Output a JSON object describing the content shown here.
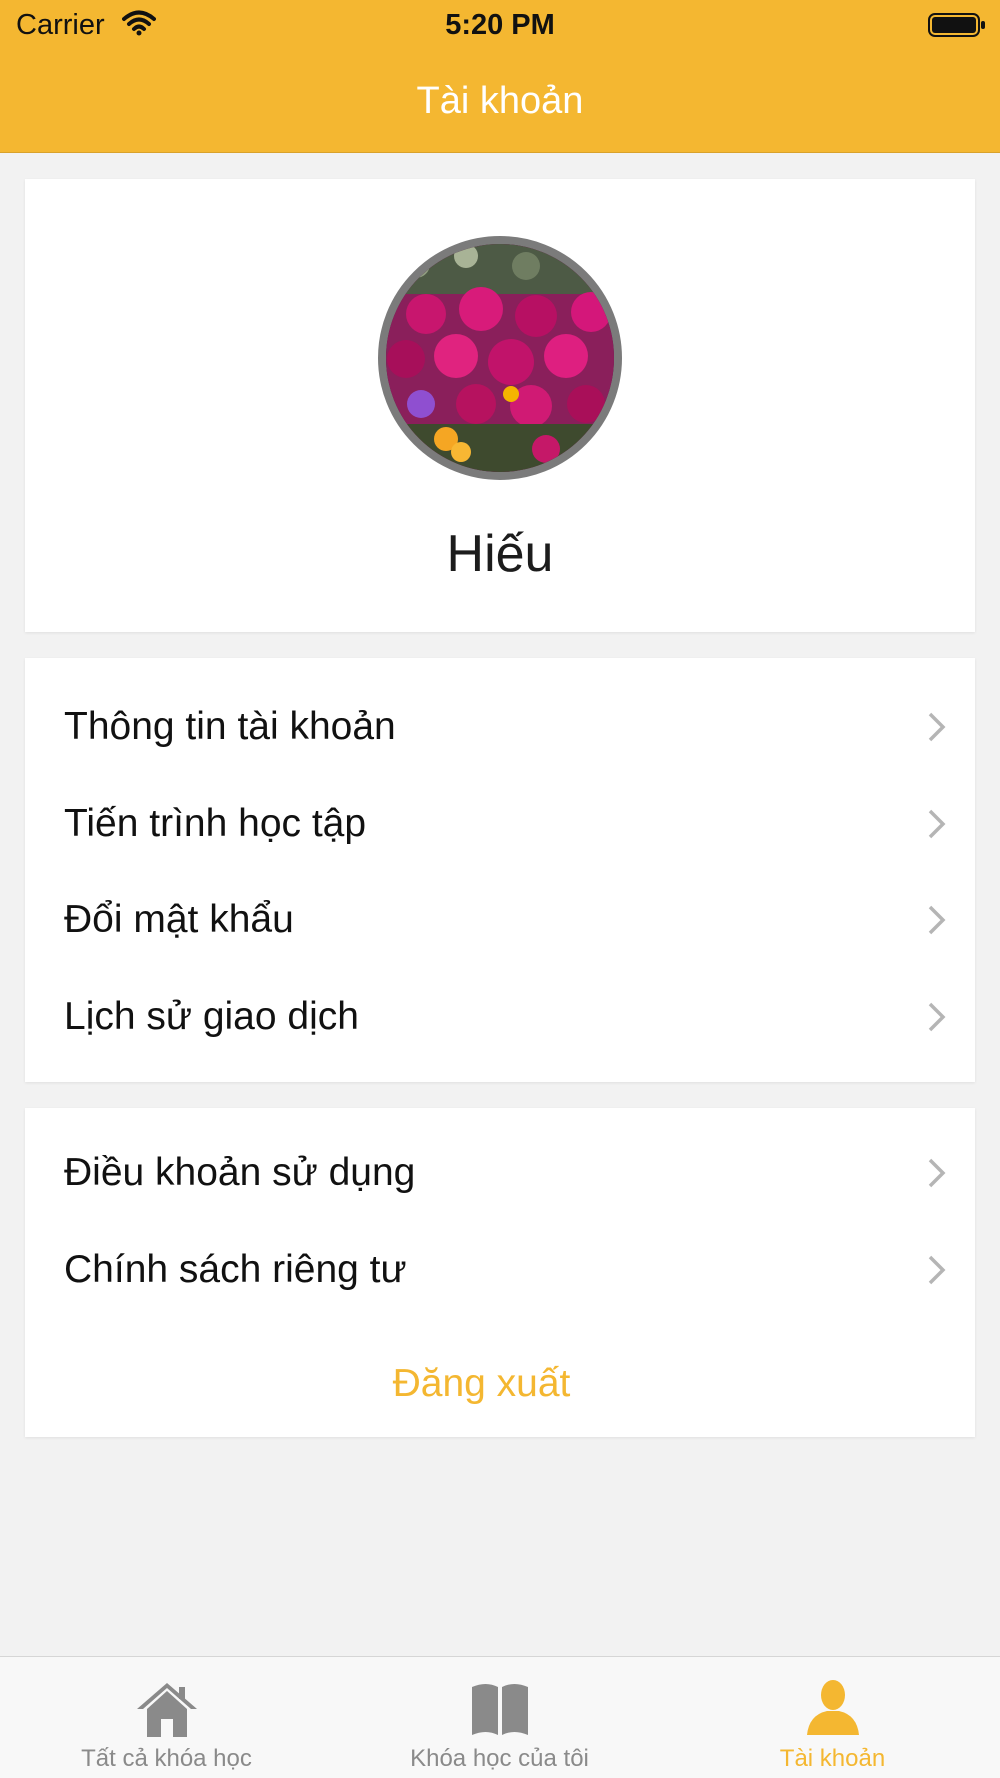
{
  "status_bar": {
    "carrier": "Carrier",
    "time": "5:20 PM"
  },
  "nav": {
    "title": "Tài khoản"
  },
  "profile": {
    "name": "Hiếu"
  },
  "menu_group_1": [
    {
      "label": "Thông tin tài khoản"
    },
    {
      "label": "Tiến trình học tập"
    },
    {
      "label": "Đổi mật khẩu"
    },
    {
      "label": "Lịch sử giao dịch"
    }
  ],
  "menu_group_2": [
    {
      "label": "Điều khoản sử dụng"
    },
    {
      "label": "Chính sách riêng tư"
    }
  ],
  "logout_label": "Đăng xuất",
  "tabs": [
    {
      "label": "Tất cả khóa học",
      "icon": "home-icon"
    },
    {
      "label": "Khóa học của tôi",
      "icon": "book-icon"
    },
    {
      "label": "Tài khoản",
      "icon": "user-icon",
      "active": true
    }
  ],
  "colors": {
    "accent": "#f4b731",
    "background": "#f2f2f2",
    "tab_inactive": "#8a8a8a"
  }
}
